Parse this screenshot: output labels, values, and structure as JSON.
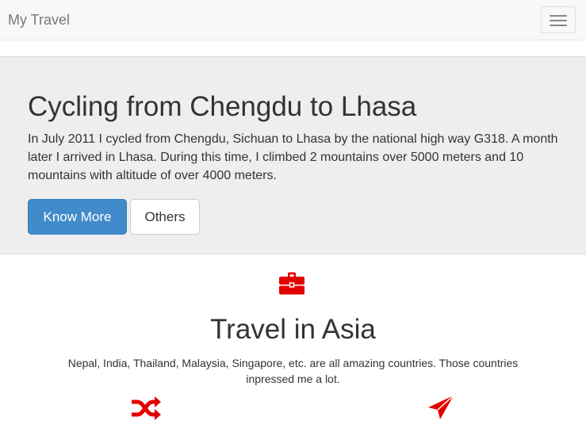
{
  "navbar": {
    "brand": "My Travel",
    "toggle_icon": "hamburger-menu-icon"
  },
  "hero": {
    "title": "Cycling from Chengdu to Lhasa",
    "description": "In July 2011 I cycled from Chengdu, Sichuan to Lhasa by the national high way G318. A month later I arrived in Lhasa. During this time, I climbed 2 mountains over 5000 meters and 10 mountains with altitude of over 4000 meters.",
    "primary_button": "Know More",
    "secondary_button": "Others"
  },
  "section": {
    "icon": "briefcase-icon",
    "title": "Travel in Asia",
    "description": "Nepal, India, Thailand, Malaysia, Singapore, etc. are all amazing countries. Those countries inpressed me a lot.",
    "feature_icons": [
      "random-icon",
      "send-icon"
    ]
  },
  "colors": {
    "navbar_bg": "#f8f8f8",
    "jumbotron_bg": "#eeeeee",
    "primary": "#428bca",
    "accent_icons": "#e50000",
    "text": "#333333"
  }
}
